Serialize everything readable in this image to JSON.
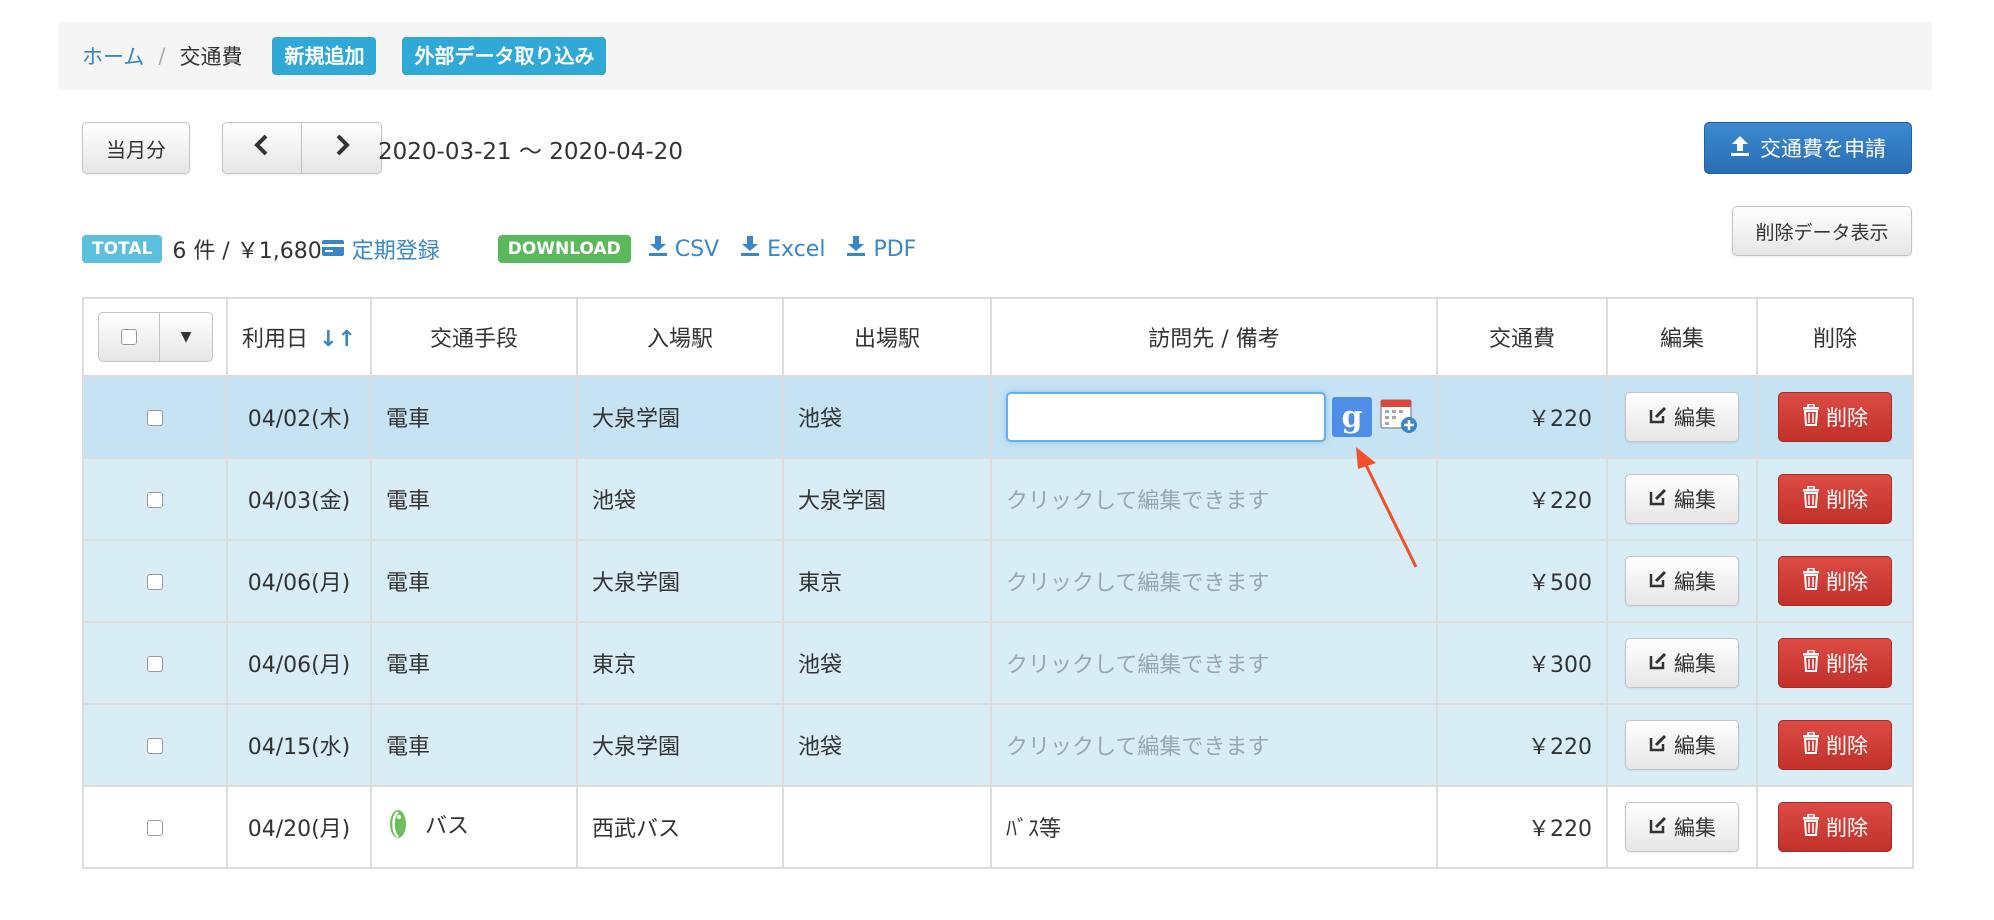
{
  "breadcrumb": {
    "home": "ホーム",
    "separator": "/",
    "current": "交通費"
  },
  "top_actions": {
    "add_new": "新規追加",
    "import": "外部データ取り込み"
  },
  "toolbar": {
    "current_month": "当月分",
    "prev": "‹",
    "next": "›",
    "date_range": "2020-03-21 〜 2020-04-20",
    "apply": "交通費を申請",
    "show_deleted": "削除データ表示"
  },
  "summary": {
    "total_label": "TOTAL",
    "total_text": "6 件 / ￥1,680",
    "regular_link": "定期登録",
    "download_label": "DOWNLOAD",
    "csv": "CSV",
    "excel": "Excel",
    "pdf": "PDF"
  },
  "table": {
    "headers": {
      "date": "利用日",
      "sort_icon": "↓↑",
      "transport": "交通手段",
      "entry": "入場駅",
      "exit": "出場駅",
      "note": "訪問先 / 備考",
      "fare": "交通費",
      "edit": "編集",
      "delete": "削除"
    },
    "edit_label": "編集",
    "delete_label": "削除",
    "note_placeholder": "クリックして編集できます",
    "rows": [
      {
        "date": "04/02(木)",
        "transport": "電車",
        "entry": "大泉学園",
        "exit": "池袋",
        "note": "",
        "fare": "￥220"
      },
      {
        "date": "04/03(金)",
        "transport": "電車",
        "entry": "池袋",
        "exit": "大泉学園",
        "note": "クリックして編集できます",
        "fare": "￥220"
      },
      {
        "date": "04/06(月)",
        "transport": "電車",
        "entry": "大泉学園",
        "exit": "東京",
        "note": "クリックして編集できます",
        "fare": "￥500"
      },
      {
        "date": "04/06(月)",
        "transport": "電車",
        "entry": "東京",
        "exit": "池袋",
        "note": "クリックして編集できます",
        "fare": "￥300"
      },
      {
        "date": "04/15(水)",
        "transport": "電車",
        "entry": "大泉学園",
        "exit": "池袋",
        "note": "クリックして編集できます",
        "fare": "￥220"
      },
      {
        "date": "04/20(月)",
        "transport": "バス",
        "entry": "西武バス",
        "exit": "",
        "note": "ﾊﾞｽ等",
        "fare": "￥220"
      }
    ]
  },
  "colors": {
    "link": "#3a87c8",
    "info": "#31a9d6",
    "primary": "#2a6db3",
    "success": "#5cb85c",
    "danger": "#c2302a",
    "row_active": "#c5e3f3",
    "row_highlight": "#d9edf7",
    "annotation_arrow": "#f0502a"
  }
}
